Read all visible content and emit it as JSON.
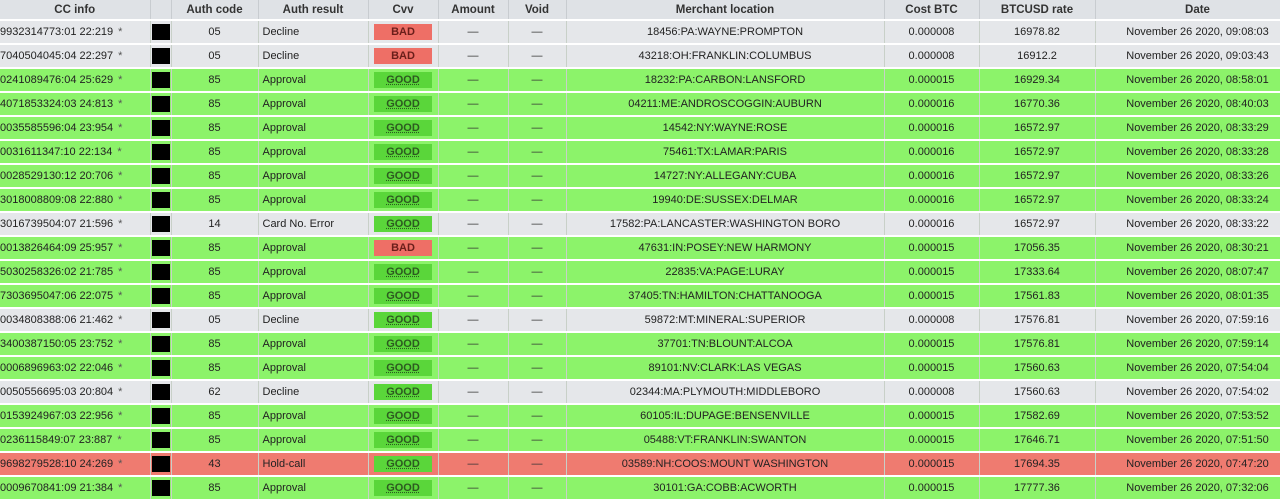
{
  "headers": [
    "CC info",
    "",
    "Auth code",
    "Auth result",
    "Cvv",
    "Amount",
    "Void",
    "Merchant location",
    "Cost BTC",
    "BTCUSD rate",
    "Date"
  ],
  "dash": "—",
  "star": "*",
  "status_colors": {
    "approval": "#8cf36a",
    "decline": "#e5e7ea",
    "holdcall": "#ef7b70",
    "good": "#5ad63a",
    "bad": "#ee6f66"
  },
  "rows": [
    {
      "cc": "9932314773:01 22:219",
      "code": "05",
      "result": "Decline",
      "cvv": "BAD",
      "location": "18456:PA:WAYNE:PROMPTON",
      "cost": "0.000008",
      "rate": "16978.82",
      "date": "November 26 2020, 09:08:03",
      "status": "decline"
    },
    {
      "cc": "7040504045:04 22:297",
      "code": "05",
      "result": "Decline",
      "cvv": "BAD",
      "location": "43218:OH:FRANKLIN:COLUMBUS",
      "cost": "0.000008",
      "rate": "16912.2",
      "date": "November 26 2020, 09:03:43",
      "status": "decline"
    },
    {
      "cc": "0241089476:04 25:629",
      "code": "85",
      "result": "Approval",
      "cvv": "GOOD",
      "location": "18232:PA:CARBON:LANSFORD",
      "cost": "0.000015",
      "rate": "16929.34",
      "date": "November 26 2020, 08:58:01",
      "status": "approval"
    },
    {
      "cc": "4071853324:03 24:813",
      "code": "85",
      "result": "Approval",
      "cvv": "GOOD",
      "location": "04211:ME:ANDROSCOGGIN:AUBURN",
      "cost": "0.000016",
      "rate": "16770.36",
      "date": "November 26 2020, 08:40:03",
      "status": "approval"
    },
    {
      "cc": "0035585596:04 23:954",
      "code": "85",
      "result": "Approval",
      "cvv": "GOOD",
      "location": "14542:NY:WAYNE:ROSE",
      "cost": "0.000016",
      "rate": "16572.97",
      "date": "November 26 2020, 08:33:29",
      "status": "approval"
    },
    {
      "cc": "0031611347:10 22:134",
      "code": "85",
      "result": "Approval",
      "cvv": "GOOD",
      "location": "75461:TX:LAMAR:PARIS",
      "cost": "0.000016",
      "rate": "16572.97",
      "date": "November 26 2020, 08:33:28",
      "status": "approval"
    },
    {
      "cc": "0028529130:12 20:706",
      "code": "85",
      "result": "Approval",
      "cvv": "GOOD",
      "location": "14727:NY:ALLEGANY:CUBA",
      "cost": "0.000016",
      "rate": "16572.97",
      "date": "November 26 2020, 08:33:26",
      "status": "approval"
    },
    {
      "cc": "3018008809:08 22:880",
      "code": "85",
      "result": "Approval",
      "cvv": "GOOD",
      "location": "19940:DE:SUSSEX:DELMAR",
      "cost": "0.000016",
      "rate": "16572.97",
      "date": "November 26 2020, 08:33:24",
      "status": "approval"
    },
    {
      "cc": "3016739504:07 21:596",
      "code": "14",
      "result": "Card No. Error",
      "cvv": "GOOD",
      "location": "17582:PA:LANCASTER:WASHINGTON BORO",
      "cost": "0.000016",
      "rate": "16572.97",
      "date": "November 26 2020, 08:33:22",
      "status": "decline"
    },
    {
      "cc": "0013826464:09 25:957",
      "code": "85",
      "result": "Approval",
      "cvv": "BAD",
      "location": "47631:IN:POSEY:NEW HARMONY",
      "cost": "0.000015",
      "rate": "17056.35",
      "date": "November 26 2020, 08:30:21",
      "status": "approval"
    },
    {
      "cc": "5030258326:02 21:785",
      "code": "85",
      "result": "Approval",
      "cvv": "GOOD",
      "location": "22835:VA:PAGE:LURAY",
      "cost": "0.000015",
      "rate": "17333.64",
      "date": "November 26 2020, 08:07:47",
      "status": "approval"
    },
    {
      "cc": "7303695047:06 22:075",
      "code": "85",
      "result": "Approval",
      "cvv": "GOOD",
      "location": "37405:TN:HAMILTON:CHATTANOOGA",
      "cost": "0.000015",
      "rate": "17561.83",
      "date": "November 26 2020, 08:01:35",
      "status": "approval"
    },
    {
      "cc": "0034808388:06 21:462",
      "code": "05",
      "result": "Decline",
      "cvv": "GOOD",
      "location": "59872:MT:MINERAL:SUPERIOR",
      "cost": "0.000008",
      "rate": "17576.81",
      "date": "November 26 2020, 07:59:16",
      "status": "decline"
    },
    {
      "cc": "3400387150:05 23:752",
      "code": "85",
      "result": "Approval",
      "cvv": "GOOD",
      "location": "37701:TN:BLOUNT:ALCOA",
      "cost": "0.000015",
      "rate": "17576.81",
      "date": "November 26 2020, 07:59:14",
      "status": "approval"
    },
    {
      "cc": "0006896963:02 22:046",
      "code": "85",
      "result": "Approval",
      "cvv": "GOOD",
      "location": "89101:NV:CLARK:LAS VEGAS",
      "cost": "0.000015",
      "rate": "17560.63",
      "date": "November 26 2020, 07:54:04",
      "status": "approval"
    },
    {
      "cc": "0050556695:03 20:804",
      "code": "62",
      "result": "Decline",
      "cvv": "GOOD",
      "location": "02344:MA:PLYMOUTH:MIDDLEBORO",
      "cost": "0.000008",
      "rate": "17560.63",
      "date": "November 26 2020, 07:54:02",
      "status": "decline"
    },
    {
      "cc": "0153924967:03 22:956",
      "code": "85",
      "result": "Approval",
      "cvv": "GOOD",
      "location": "60105:IL:DUPAGE:BENSENVILLE",
      "cost": "0.000015",
      "rate": "17582.69",
      "date": "November 26 2020, 07:53:52",
      "status": "approval"
    },
    {
      "cc": "0236115849:07 23:887",
      "code": "85",
      "result": "Approval",
      "cvv": "GOOD",
      "location": "05488:VT:FRANKLIN:SWANTON",
      "cost": "0.000015",
      "rate": "17646.71",
      "date": "November 26 2020, 07:51:50",
      "status": "approval"
    },
    {
      "cc": "9698279528:10 24:269",
      "code": "43",
      "result": "Hold-call",
      "cvv": "GOOD",
      "location": "03589:NH:COOS:MOUNT WASHINGTON",
      "cost": "0.000015",
      "rate": "17694.35",
      "date": "November 26 2020, 07:47:20",
      "status": "holdcall"
    },
    {
      "cc": "0009670841:09 21:384",
      "code": "85",
      "result": "Approval",
      "cvv": "GOOD",
      "location": "30101:GA:COBB:ACWORTH",
      "cost": "0.000015",
      "rate": "17777.36",
      "date": "November 26 2020, 07:32:06",
      "status": "approval"
    }
  ]
}
